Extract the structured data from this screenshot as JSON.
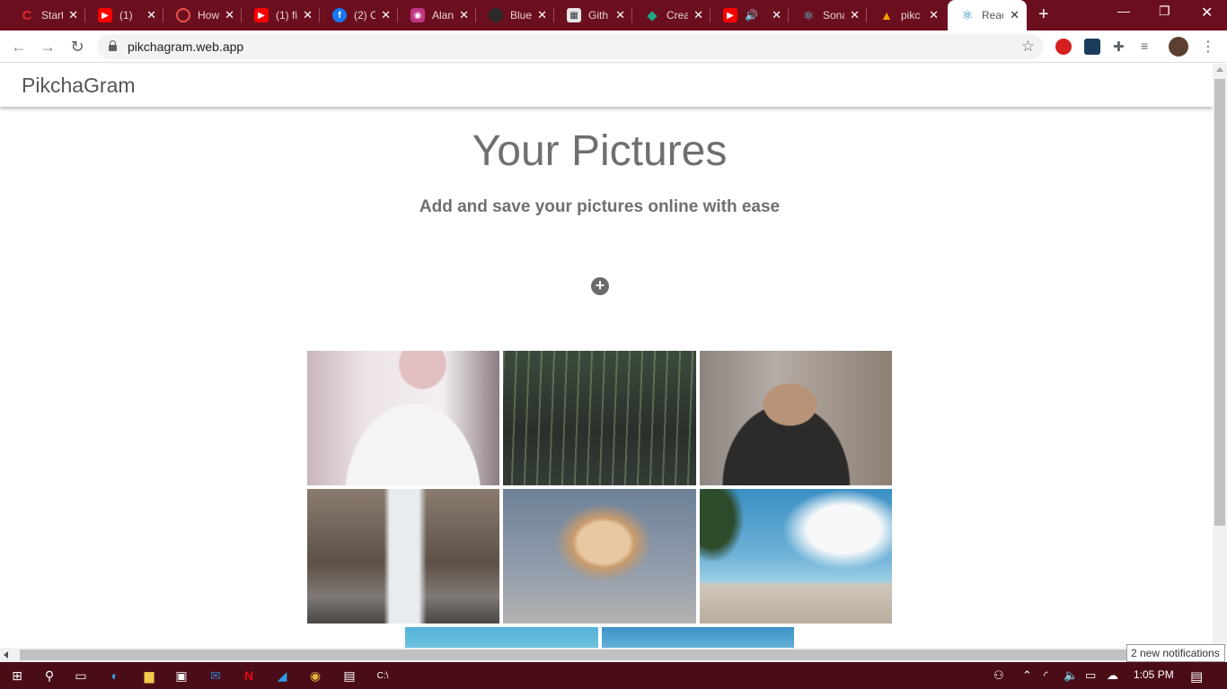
{
  "browser": {
    "tabs": [
      {
        "title": "Start",
        "favicon_color": "#e0282e",
        "favicon_glyph": "C"
      },
      {
        "title": "(1)",
        "favicon_color": "#ff0000",
        "favicon_glyph": "▶"
      },
      {
        "title": "How",
        "favicon_color": "#e8554e",
        "favicon_glyph": "◎"
      },
      {
        "title": "(1) fi",
        "favicon_color": "#ff0000",
        "favicon_glyph": "▶"
      },
      {
        "title": "(2) C",
        "favicon_color": "#1877f2",
        "favicon_glyph": "f"
      },
      {
        "title": "Alan",
        "favicon_color": "#c13584",
        "favicon_glyph": "◉"
      },
      {
        "title": "Blue",
        "favicon_color": "#333333",
        "favicon_glyph": "●"
      },
      {
        "title": "Gith",
        "favicon_color": "#dddddd",
        "favicon_glyph": "▦"
      },
      {
        "title": "Crea",
        "favicon_color": "#1ea784",
        "favicon_glyph": "◆"
      },
      {
        "title": "",
        "favicon_color": "#ff0000",
        "favicon_glyph": "▶"
      },
      {
        "title": "Sona",
        "favicon_color": "#61dafb",
        "favicon_glyph": "⚛"
      },
      {
        "title": "pikc",
        "favicon_color": "#ffa000",
        "favicon_glyph": "🔥"
      },
      {
        "title": "Reac",
        "favicon_color": "#61dafb",
        "favicon_glyph": "⚛"
      }
    ],
    "address": "pikchagram.web.app"
  },
  "app": {
    "brand": "PikchaGram",
    "title": "Your Pictures",
    "subtitle": "Add and save your pictures online with ease",
    "add_icon": "plus-circle-icon",
    "photos": [
      {
        "name": "woman-white-scarf"
      },
      {
        "name": "light-streaks"
      },
      {
        "name": "man-glasses-portrait"
      },
      {
        "name": "waterfall"
      },
      {
        "name": "sunset-cloud"
      },
      {
        "name": "tropical-beach"
      },
      {
        "name": "palm-sky"
      },
      {
        "name": "blue-sky"
      }
    ]
  },
  "notification": {
    "text": "2 new notifications"
  },
  "taskbar": {
    "time": "1:05 PM"
  }
}
